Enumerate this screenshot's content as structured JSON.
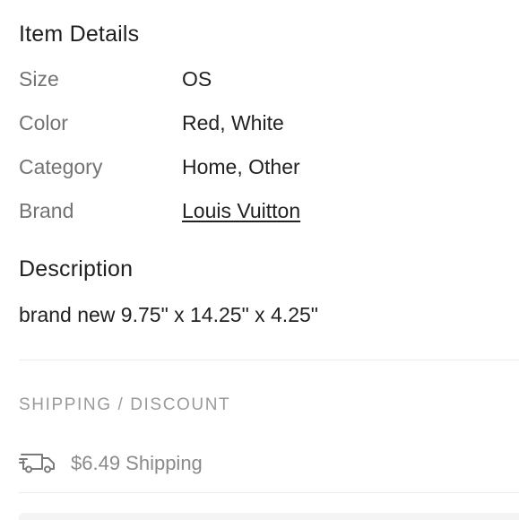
{
  "item_details": {
    "title": "Item Details",
    "rows": [
      {
        "label": "Size",
        "value": "OS"
      },
      {
        "label": "Color",
        "value": "Red, White"
      },
      {
        "label": "Category",
        "value": "Home, Other"
      },
      {
        "label": "Brand",
        "value": "Louis Vuitton"
      }
    ]
  },
  "description": {
    "title": "Description",
    "text": "brand new 9.75\" x 14.25\" x 4.25\""
  },
  "shipping": {
    "heading": "SHIPPING / DISCOUNT",
    "text": "$6.49 Shipping",
    "icon": "truck-icon"
  }
}
